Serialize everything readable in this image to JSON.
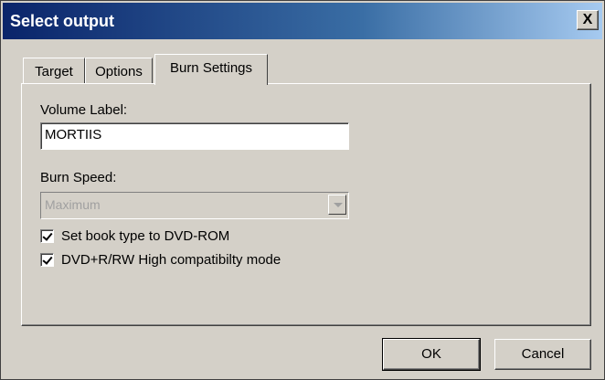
{
  "window": {
    "title": "Select output",
    "close_label": "X"
  },
  "tabs": [
    {
      "label": "Target"
    },
    {
      "label": "Options"
    },
    {
      "label": "Burn Settings"
    }
  ],
  "burn_settings": {
    "volume_label": {
      "label": "Volume Label:",
      "value": "MORTIIS"
    },
    "burn_speed": {
      "label": "Burn Speed:",
      "selected": "Maximum",
      "enabled": false
    },
    "checkboxes": [
      {
        "label": "Set book type to DVD-ROM",
        "checked": true
      },
      {
        "label": "DVD+R/RW High compatibilty mode",
        "checked": true
      }
    ]
  },
  "buttons": {
    "ok": "OK",
    "cancel": "Cancel"
  }
}
